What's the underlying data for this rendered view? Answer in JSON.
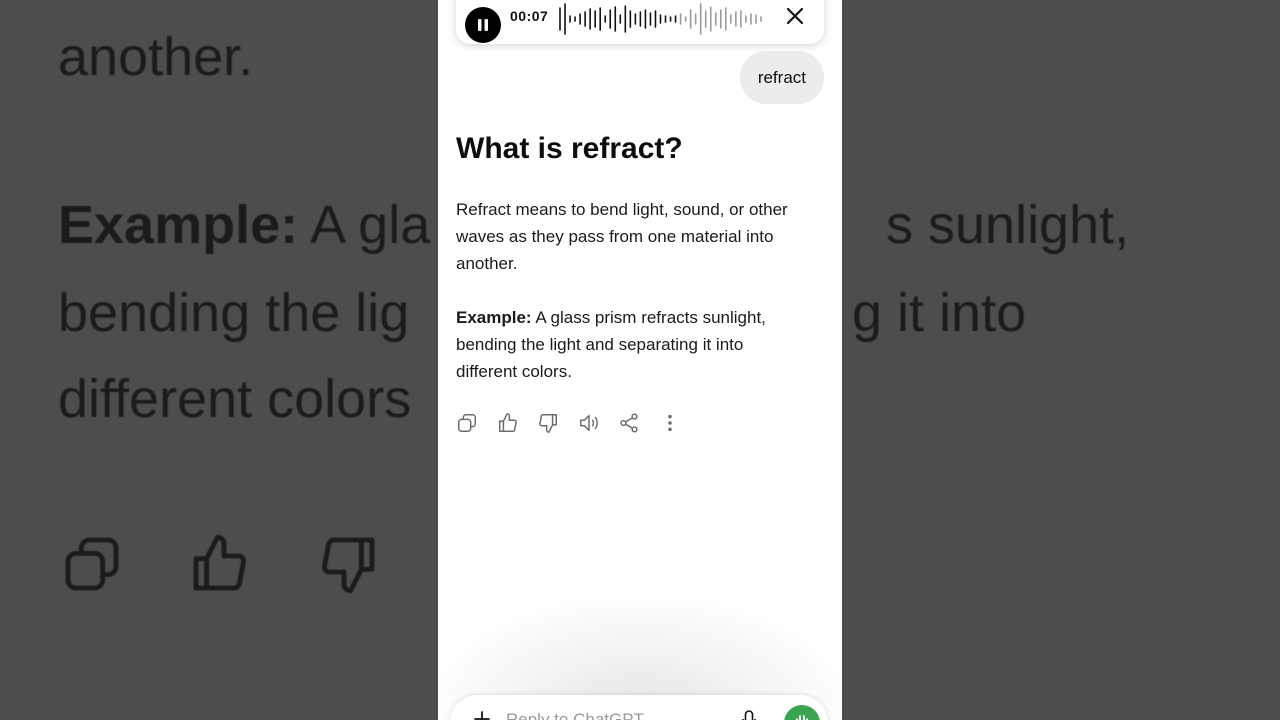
{
  "background": {
    "line1": "another.",
    "example_label": "Example:",
    "line2_rest": " A gla",
    "line2_tail": "s sunlight,",
    "line3_a": "bending the lig",
    "line3_b": "g it into",
    "line4": "different colors"
  },
  "voice_bar": {
    "timer": "00:07",
    "pause_icon": "pause-icon",
    "close_icon": "close-icon"
  },
  "chat": {
    "user_message": "refract",
    "title": "What is refract?",
    "definition": "Refract means to bend light, sound, or other waves as they pass from one material into another.",
    "example_label": "Example:",
    "example_text": " A glass prism refracts sunlight, bending the light and separating it into different colors."
  },
  "actions": [
    "copy-icon",
    "thumbs-up-icon",
    "thumbs-down-icon",
    "read-aloud-icon",
    "share-icon",
    "more-icon"
  ],
  "composer": {
    "placeholder": "Reply to ChatGPT"
  },
  "colors": {
    "voice_button": "#3aa550",
    "background": "#4d4d4d",
    "bubble": "#ececec"
  }
}
